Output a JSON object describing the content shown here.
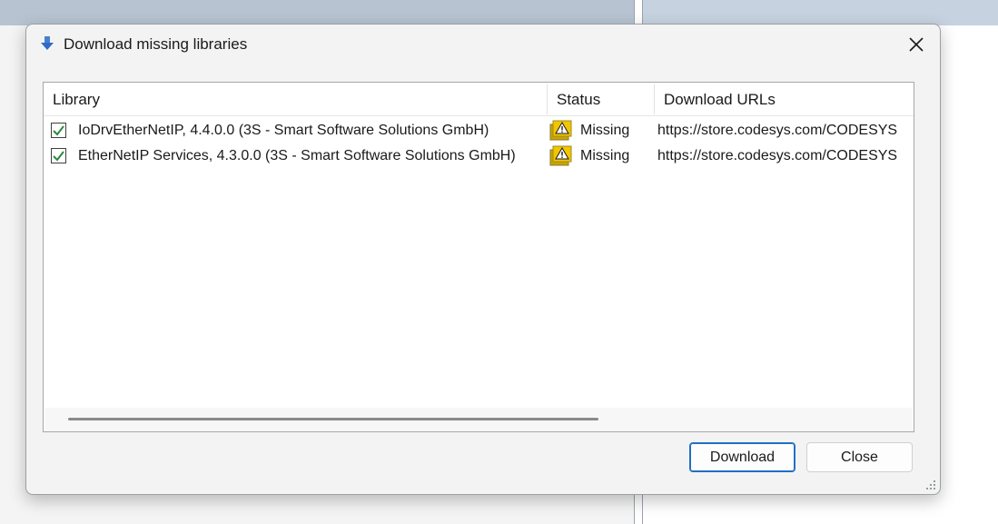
{
  "dialog": {
    "title": "Download missing libraries",
    "icon": "download-arrow-icon",
    "close_icon": "close-icon"
  },
  "table": {
    "columns": [
      "Library",
      "Status",
      "Download URLs"
    ],
    "rows": [
      {
        "checked": true,
        "library": "IoDrvEtherNetIP, 4.4.0.0 (3S - Smart Software Solutions GmbH)",
        "status": "Missing",
        "status_icon": "warning-icon",
        "url": "https://store.codesys.com/CODESYS"
      },
      {
        "checked": true,
        "library": "EtherNetIP Services, 4.3.0.0 (3S - Smart Software Solutions GmbH)",
        "status": "Missing",
        "status_icon": "warning-icon",
        "url": "https://store.codesys.com/CODESYS"
      }
    ]
  },
  "buttons": {
    "download": "Download",
    "close": "Close"
  },
  "colors": {
    "accent": "#1f6fc4",
    "warning": "#f2c500",
    "checkmark": "#2a8a3e"
  }
}
